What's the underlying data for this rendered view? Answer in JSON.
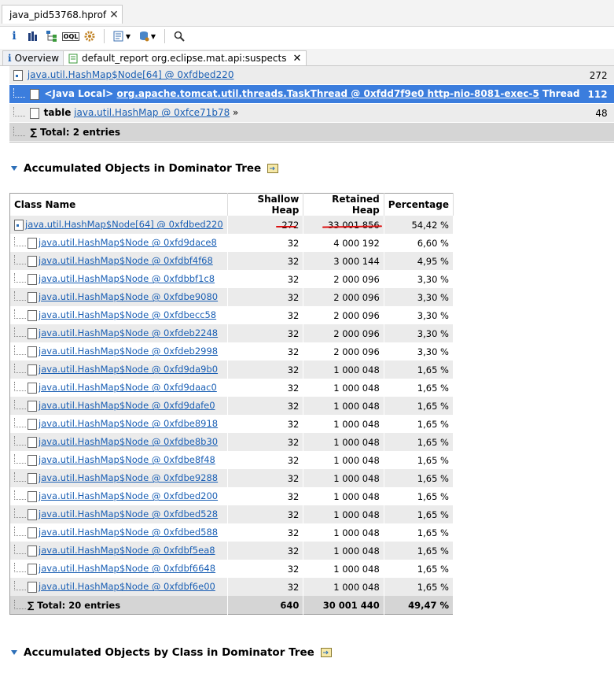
{
  "editor_tab": {
    "label": "java_pid53768.hprof",
    "close": "✕"
  },
  "toolbar": {
    "info": "i",
    "histogram": "histogram-icon",
    "dominator": "dominator-tree-icon",
    "oql": "OQL",
    "threads": "thread-overview-icon",
    "reports": "reports-icon",
    "heapdump": "heap-dump-icon",
    "search": "search-icon"
  },
  "inner_tabs": [
    {
      "label": "Overview"
    },
    {
      "label": "default_report org.eclipse.mat.api:suspects",
      "close": "✕"
    }
  ],
  "top_rows": [
    {
      "name": "java.util.HashMap$Node[64] @ 0xfdbed220",
      "value": "272",
      "type": "link-row"
    },
    {
      "prefix": "<Java Local>",
      "name": "org.apache.tomcat.util.threads.TaskThread @ 0xfdd7f9e0 http-nio-8081-exec-5",
      "suffix": "Thread",
      "value": "112",
      "type": "selected"
    },
    {
      "prefix": "table",
      "name": "java.util.HashMap @ 0xfce71b78",
      "suffix": "»",
      "value": "48",
      "type": "link-row"
    },
    {
      "name": "Total: 2 entries",
      "value": "",
      "type": "total"
    }
  ],
  "sections": {
    "accumulated_dominator": "Accumulated Objects in Dominator Tree",
    "accumulated_by_class": "Accumulated Objects by Class in Dominator Tree"
  },
  "dom_table": {
    "headers": [
      "Class Name",
      "Shallow Heap",
      "Retained Heap",
      "Percentage"
    ],
    "rows": [
      {
        "name": "java.util.HashMap$Node[64] @ 0xfdbed220",
        "shallow": "272",
        "retained": "33 001 856",
        "pct": "54,42 %",
        "root": true
      },
      {
        "name": "java.util.HashMap$Node @ 0xfd9dace8",
        "shallow": "32",
        "retained": "4 000 192",
        "pct": "6,60 %"
      },
      {
        "name": "java.util.HashMap$Node @ 0xfdbf4f68",
        "shallow": "32",
        "retained": "3 000 144",
        "pct": "4,95 %"
      },
      {
        "name": "java.util.HashMap$Node @ 0xfdbbf1c8",
        "shallow": "32",
        "retained": "2 000 096",
        "pct": "3,30 %"
      },
      {
        "name": "java.util.HashMap$Node @ 0xfdbe9080",
        "shallow": "32",
        "retained": "2 000 096",
        "pct": "3,30 %"
      },
      {
        "name": "java.util.HashMap$Node @ 0xfdbecc58",
        "shallow": "32",
        "retained": "2 000 096",
        "pct": "3,30 %"
      },
      {
        "name": "java.util.HashMap$Node @ 0xfdeb2248",
        "shallow": "32",
        "retained": "2 000 096",
        "pct": "3,30 %"
      },
      {
        "name": "java.util.HashMap$Node @ 0xfdeb2998",
        "shallow": "32",
        "retained": "2 000 096",
        "pct": "3,30 %"
      },
      {
        "name": "java.util.HashMap$Node @ 0xfd9da9b0",
        "shallow": "32",
        "retained": "1 000 048",
        "pct": "1,65 %"
      },
      {
        "name": "java.util.HashMap$Node @ 0xfd9daac0",
        "shallow": "32",
        "retained": "1 000 048",
        "pct": "1,65 %"
      },
      {
        "name": "java.util.HashMap$Node @ 0xfd9dafe0",
        "shallow": "32",
        "retained": "1 000 048",
        "pct": "1,65 %"
      },
      {
        "name": "java.util.HashMap$Node @ 0xfdbe8918",
        "shallow": "32",
        "retained": "1 000 048",
        "pct": "1,65 %"
      },
      {
        "name": "java.util.HashMap$Node @ 0xfdbe8b30",
        "shallow": "32",
        "retained": "1 000 048",
        "pct": "1,65 %"
      },
      {
        "name": "java.util.HashMap$Node @ 0xfdbe8f48",
        "shallow": "32",
        "retained": "1 000 048",
        "pct": "1,65 %"
      },
      {
        "name": "java.util.HashMap$Node @ 0xfdbe9288",
        "shallow": "32",
        "retained": "1 000 048",
        "pct": "1,65 %"
      },
      {
        "name": "java.util.HashMap$Node @ 0xfdbed200",
        "shallow": "32",
        "retained": "1 000 048",
        "pct": "1,65 %"
      },
      {
        "name": "java.util.HashMap$Node @ 0xfdbed528",
        "shallow": "32",
        "retained": "1 000 048",
        "pct": "1,65 %"
      },
      {
        "name": "java.util.HashMap$Node @ 0xfdbed588",
        "shallow": "32",
        "retained": "1 000 048",
        "pct": "1,65 %"
      },
      {
        "name": "java.util.HashMap$Node @ 0xfdbf5ea8",
        "shallow": "32",
        "retained": "1 000 048",
        "pct": "1,65 %"
      },
      {
        "name": "java.util.HashMap$Node @ 0xfdbf6648",
        "shallow": "32",
        "retained": "1 000 048",
        "pct": "1,65 %"
      },
      {
        "name": "java.util.HashMap$Node @ 0xfdbf6e00",
        "shallow": "32",
        "retained": "1 000 048",
        "pct": "1,65 %"
      }
    ],
    "total": {
      "name": "Total: 20 entries",
      "shallow": "640",
      "retained": "30 001 440",
      "pct": "49,47 %"
    }
  },
  "colors": {
    "selection": "#3b7ddd",
    "link": "#1a5fb4",
    "annotation": "#dd1111"
  }
}
